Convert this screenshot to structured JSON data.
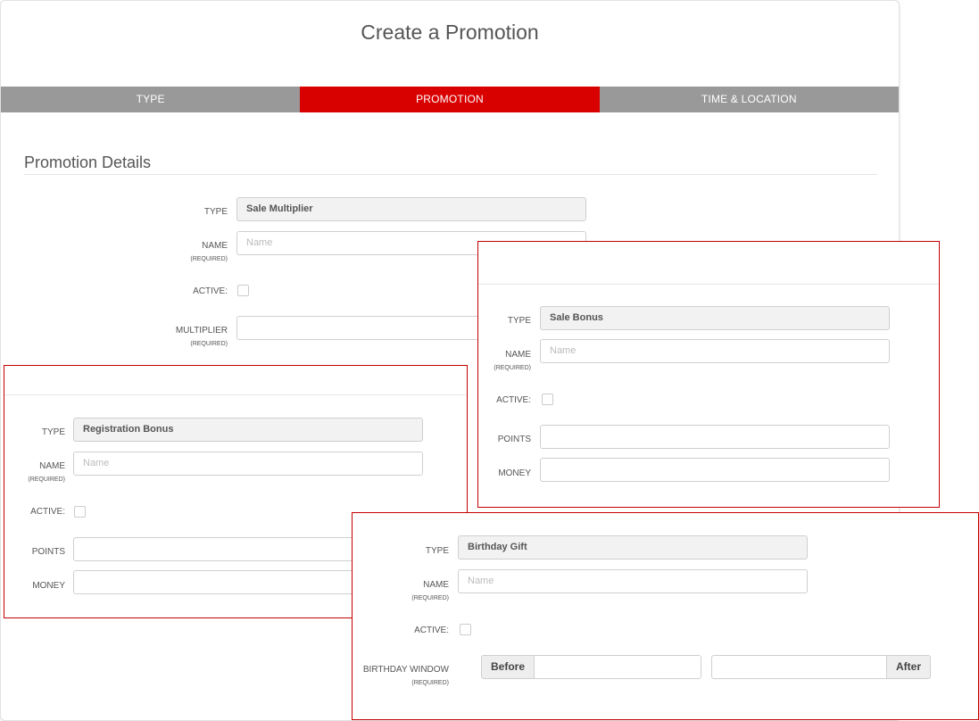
{
  "page": {
    "title": "Create a Promotion",
    "steps": [
      "TYPE",
      "PROMOTION",
      "TIME & LOCATION"
    ],
    "active_step": "PROMOTION",
    "section_title": "Promotion Details"
  },
  "labels": {
    "type": "TYPE",
    "name": "NAME",
    "required": "(REQUIRED)",
    "active": "ACTIVE:",
    "multiplier": "MULTIPLIER",
    "points": "POINTS",
    "money": "MONEY",
    "birthday_window": "BIRTHDAY WINDOW",
    "before": "Before",
    "after": "After"
  },
  "main_form": {
    "type_value": "Sale Multiplier",
    "name_placeholder": "Name"
  },
  "registration_form": {
    "type_value": "Registration Bonus",
    "name_placeholder": "Name"
  },
  "sale_bonus_form": {
    "type_value": "Sale Bonus",
    "name_placeholder": "Name"
  },
  "birthday_form": {
    "type_value": "Birthday Gift",
    "name_placeholder": "Name"
  },
  "colors": {
    "accent": "#d90000",
    "step_inactive": "#999999",
    "overlay_border": "#c40000"
  }
}
